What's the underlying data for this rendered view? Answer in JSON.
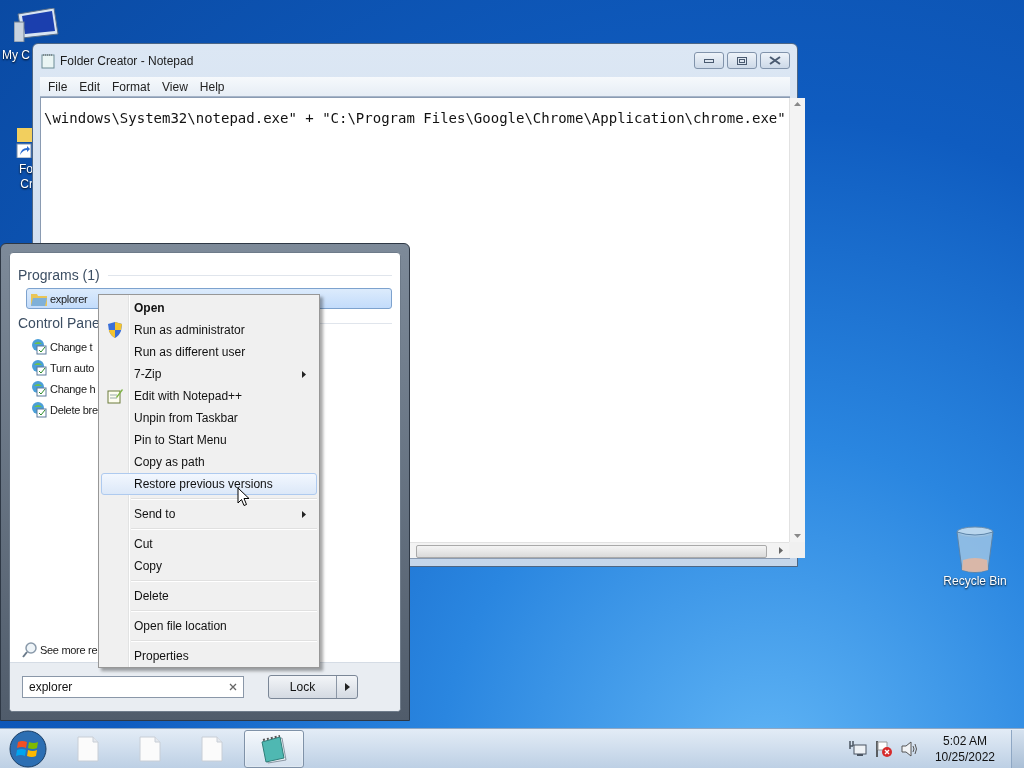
{
  "desktop": {
    "icons": [
      {
        "kind": "computer",
        "lines": [
          "My C"
        ]
      },
      {
        "kind": "shortcut",
        "lines": [
          "Fo",
          "Cr"
        ]
      },
      {
        "kind": "recycle-bin",
        "lines": [
          "Recycle Bin"
        ]
      }
    ]
  },
  "notepad": {
    "title": "Folder Creator - Notepad",
    "menu": [
      "File",
      "Edit",
      "Format",
      "View",
      "Help"
    ],
    "text": "\\windows\\System32\\notepad.exe\" + \"C:\\Program Files\\Google\\Chrome\\Application\\chrome.exe\""
  },
  "start_menu": {
    "sections": [
      {
        "title": "Programs (1)",
        "items": [
          {
            "label": "explorer",
            "kind": "program",
            "selected": true
          }
        ]
      },
      {
        "title": "Control Pane",
        "items": [
          {
            "label": "Change t",
            "kind": "control-panel",
            "selected": false
          },
          {
            "label": "Turn auto",
            "kind": "control-panel",
            "selected": false
          },
          {
            "label": "Change h",
            "kind": "control-panel",
            "selected": false
          },
          {
            "label": "Delete bre",
            "kind": "control-panel",
            "selected": false
          }
        ]
      }
    ],
    "see_more": "See more re",
    "search": {
      "value": "explorer"
    },
    "power_button": "Lock"
  },
  "context_menu": {
    "groups": [
      {
        "items": [
          {
            "label": "Open",
            "default": true,
            "submenu": false,
            "selected": false
          },
          {
            "label": "Run as administrator",
            "kind": "elevated",
            "default": false,
            "submenu": false,
            "selected": false
          },
          {
            "label": "Run as different user",
            "default": false,
            "submenu": false,
            "selected": false
          },
          {
            "label": "7-Zip",
            "default": false,
            "submenu": true,
            "selected": false
          },
          {
            "label": "Edit with Notepad++",
            "kind": "editor",
            "default": false,
            "submenu": false,
            "selected": false
          },
          {
            "label": "Unpin from Taskbar",
            "default": false,
            "submenu": false,
            "selected": false
          },
          {
            "label": "Pin to Start Menu",
            "default": false,
            "submenu": false,
            "selected": false
          },
          {
            "label": "Copy as path",
            "default": false,
            "submenu": false,
            "selected": false
          },
          {
            "label": "Restore previous versions",
            "default": false,
            "submenu": false,
            "selected": true
          }
        ]
      },
      {
        "items": [
          {
            "label": "Send to",
            "default": false,
            "submenu": true,
            "selected": false
          }
        ]
      },
      {
        "items": [
          {
            "label": "Cut",
            "default": false,
            "submenu": false,
            "selected": false
          },
          {
            "label": "Copy",
            "default": false,
            "submenu": false,
            "selected": false
          }
        ]
      },
      {
        "items": [
          {
            "label": "Delete",
            "default": false,
            "submenu": false,
            "selected": false
          }
        ]
      },
      {
        "items": [
          {
            "label": "Open file location",
            "default": false,
            "submenu": false,
            "selected": false
          }
        ]
      },
      {
        "items": [
          {
            "label": "Properties",
            "default": false,
            "submenu": false,
            "selected": false
          }
        ]
      }
    ]
  },
  "taskbar": {
    "buttons": [
      {
        "kind": "document",
        "selected": false
      },
      {
        "kind": "document",
        "selected": false
      },
      {
        "kind": "document",
        "selected": false
      },
      {
        "kind": "notepad",
        "selected": true
      }
    ],
    "clock": {
      "time": "5:02 AM",
      "date": "10/25/2022"
    }
  }
}
